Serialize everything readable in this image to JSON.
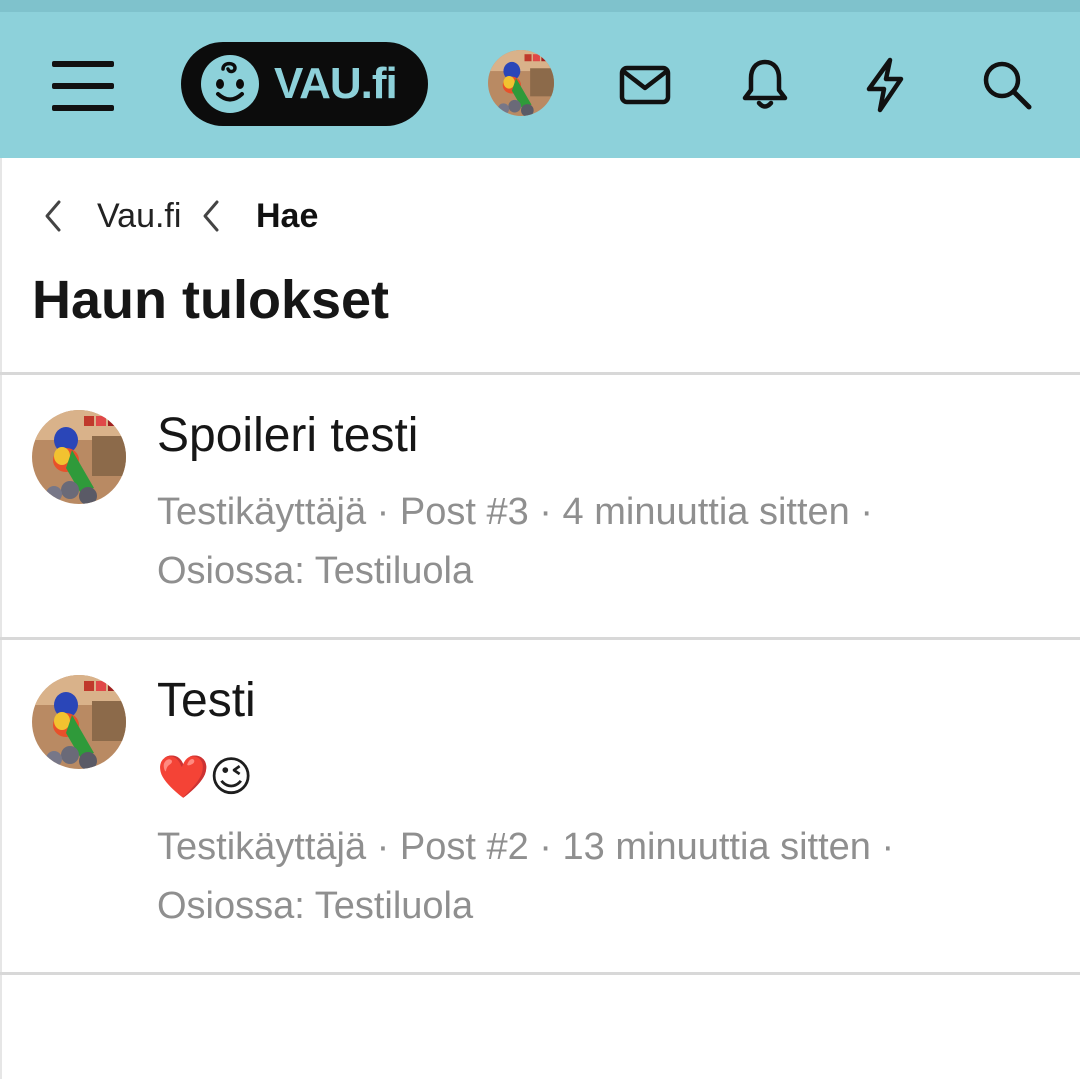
{
  "header": {
    "logo_text": "VAU.fi",
    "icons": [
      "menu-icon",
      "baby-face-icon",
      "avatar",
      "mail-icon",
      "bell-icon",
      "lightning-icon",
      "search-icon"
    ],
    "bg_color": "#8dd1da"
  },
  "breadcrumb": {
    "items": [
      "Vau.fi",
      "Hae"
    ]
  },
  "page": {
    "title": "Haun tulokset"
  },
  "results": [
    {
      "title": "Spoileri testi",
      "snippet": "",
      "user": "Testikäyttäjä",
      "post": "Post #3",
      "time": "4 minuuttia sitten",
      "forum": "Osiossa: Testiluola"
    },
    {
      "title": "Testi",
      "snippet": "❤️😉",
      "user": "Testikäyttäjä",
      "post": "Post #2",
      "time": "13 minuuttia sitten",
      "forum": "Osiossa: Testiluola"
    }
  ],
  "separator": " · "
}
